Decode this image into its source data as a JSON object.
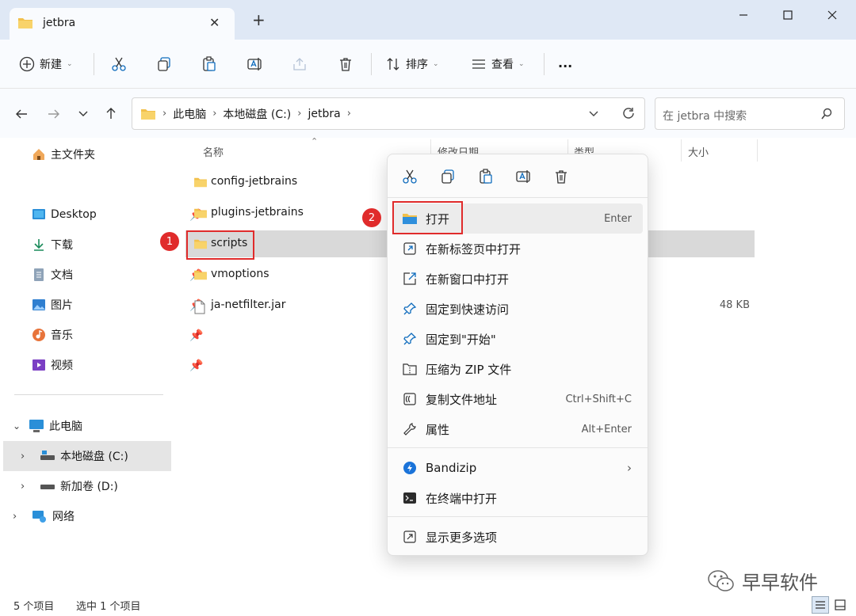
{
  "window": {
    "tab_title": "jetbra",
    "new_tab": "+"
  },
  "toolbar": {
    "new_label": "新建",
    "sort_label": "排序",
    "view_label": "查看",
    "more": "..."
  },
  "breadcrumb": [
    "此电脑",
    "本地磁盘 (C:)",
    "jetbra"
  ],
  "search": {
    "placeholder": "在 jetbra 中搜索"
  },
  "sidebar": {
    "home": "主文件夹",
    "quick": [
      "Desktop",
      "下载",
      "文档",
      "图片",
      "音乐",
      "视频"
    ],
    "this_pc": "此电脑",
    "drives": [
      "本地磁盘 (C:)",
      "新加卷 (D:)"
    ],
    "network": "网络"
  },
  "columns": {
    "name": "名称",
    "modified": "修改日期",
    "type": "类型",
    "size": "大小"
  },
  "files": [
    {
      "name": "config-jetbrains",
      "size": ""
    },
    {
      "name": "plugins-jetbrains",
      "size": ""
    },
    {
      "name": "scripts",
      "size": ""
    },
    {
      "name": "vmoptions",
      "size": ""
    },
    {
      "name": "ja-netfilter.jar",
      "size": "48 KB"
    }
  ],
  "menu": {
    "items": [
      {
        "label": "打开",
        "shortcut": "Enter",
        "icon": "folder-icon"
      },
      {
        "label": "在新标签页中打开",
        "shortcut": "",
        "icon": "new-tab-icon"
      },
      {
        "label": "在新窗口中打开",
        "shortcut": "",
        "icon": "new-window-icon"
      },
      {
        "label": "固定到快速访问",
        "shortcut": "",
        "icon": "pin-icon"
      },
      {
        "label": "固定到\"开始\"",
        "shortcut": "",
        "icon": "pin-icon"
      },
      {
        "label": "压缩为 ZIP 文件",
        "shortcut": "",
        "icon": "zip-icon"
      },
      {
        "label": "复制文件地址",
        "shortcut": "Ctrl+Shift+C",
        "icon": "copy-path-icon"
      },
      {
        "label": "属性",
        "shortcut": "Alt+Enter",
        "icon": "wrench-icon"
      },
      {
        "label": "Bandizip",
        "shortcut": "",
        "icon": "bandizip-icon"
      },
      {
        "label": "在终端中打开",
        "shortcut": "",
        "icon": "terminal-icon"
      },
      {
        "label": "显示更多选项",
        "shortcut": "",
        "icon": "more-options-icon"
      }
    ]
  },
  "annotations": {
    "badge1": "1",
    "badge2": "2"
  },
  "status": {
    "count": "5 个项目",
    "selected": "选中 1 个项目"
  },
  "watermark": "早早软件",
  "colors": {
    "accent": "#e02b2b",
    "folder": "#f2c04b",
    "selection": "#d9d9d9"
  }
}
